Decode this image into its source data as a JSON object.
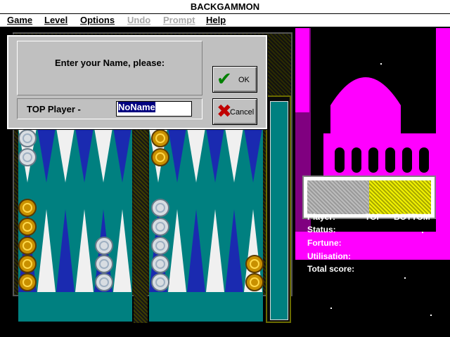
{
  "window": {
    "title": "BACKGAMMON"
  },
  "menu": [
    {
      "label": "Game",
      "enabled": true
    },
    {
      "label": "Level",
      "enabled": true
    },
    {
      "label": "Options",
      "enabled": true
    },
    {
      "label": "Undo",
      "enabled": false
    },
    {
      "label": "Prompt",
      "enabled": false
    },
    {
      "label": "Help",
      "enabled": true
    }
  ],
  "dialog": {
    "prompt": "Enter your Name, please:",
    "player_label": "TOP Player -",
    "name_value": "NoName",
    "ok_label": "OK",
    "cancel_label": "Cancel"
  },
  "info": {
    "player_label": "Player:",
    "top": "TOP",
    "bottom": "BOTTOM",
    "status_label": "Status:",
    "fortune_label": "Fortune:",
    "utilisation_label": "Utilisation:",
    "total_label": "Total score:"
  },
  "colors": {
    "board": "#008080",
    "palace": "#ff00ff",
    "checker_gold": "#c89000",
    "checker_white": "#d8dde2",
    "point_blue": "#1a2ab0",
    "point_white": "#f0f0f0"
  },
  "icons": {
    "ok": "checkmark-icon",
    "cancel": "x-cross-icon"
  }
}
